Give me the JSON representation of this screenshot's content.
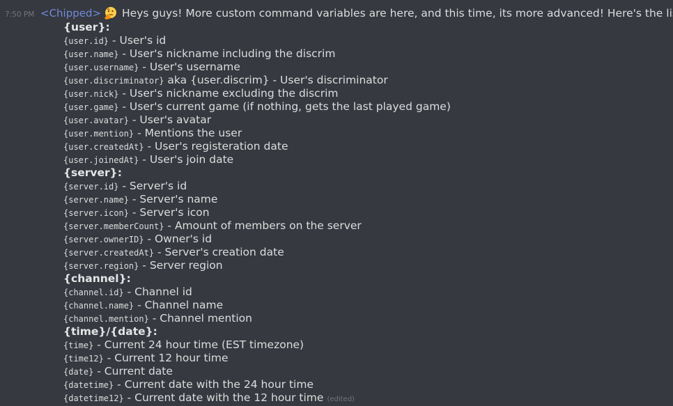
{
  "message": {
    "timestamp": "7:50 PM",
    "author": "<Chipped>",
    "emoji": "thinking-face-icon",
    "intro": "Heys guys! More custom command variables are here, and this time, its more advanced! Here's the list:",
    "edited_label": "(edited)",
    "lines": [
      {
        "type": "section",
        "text": "{user}:"
      },
      {
        "type": "item",
        "code": "{user.id}",
        "desc": " - User's id"
      },
      {
        "type": "item",
        "code": "{user.name}",
        "desc": " - User's nickname including the discrim"
      },
      {
        "type": "item",
        "code": "{user.username}",
        "desc": " - User's username"
      },
      {
        "type": "item",
        "code": "{user.discriminator}",
        "desc": " aka {user.discrim} - User's discriminator"
      },
      {
        "type": "item",
        "code": "{user.nick}",
        "desc": " - User's nickname excluding the discrim"
      },
      {
        "type": "item",
        "code": "{user.game}",
        "desc": " - User's current game (if nothing, gets the last played game)"
      },
      {
        "type": "item",
        "code": "{user.avatar}",
        "desc": " - User's avatar"
      },
      {
        "type": "item",
        "code": "{user.mention}",
        "desc": " - Mentions the user"
      },
      {
        "type": "item",
        "code": "{user.createdAt}",
        "desc": " - User's registeration date"
      },
      {
        "type": "item",
        "code": "{user.joinedAt}",
        "desc": " - User's join date"
      },
      {
        "type": "section",
        "text": "{server}:"
      },
      {
        "type": "item",
        "code": "{server.id}",
        "desc": " - Server's id"
      },
      {
        "type": "item",
        "code": "{server.name}",
        "desc": " - Server's name"
      },
      {
        "type": "item",
        "code": "{server.icon}",
        "desc": " - Server's icon"
      },
      {
        "type": "item",
        "code": "{server.memberCount}",
        "desc": " - Amount of members on the server"
      },
      {
        "type": "item",
        "code": "{server.ownerID}",
        "desc": " - Owner's id"
      },
      {
        "type": "item",
        "code": "{server.createdAt}",
        "desc": " - Server's creation date"
      },
      {
        "type": "item",
        "code": "{server.region}",
        "desc": " - Server region"
      },
      {
        "type": "section",
        "text": "{channel}:"
      },
      {
        "type": "item",
        "code": "{channel.id}",
        "desc": " - Channel id"
      },
      {
        "type": "item",
        "code": "{channel.name}",
        "desc": " - Channel name"
      },
      {
        "type": "item",
        "code": "{channel.mention}",
        "desc": " - Channel mention"
      },
      {
        "type": "section",
        "text": "{time}/{date}:"
      },
      {
        "type": "item",
        "code": "{time}",
        "desc": " - Current 24 hour time (EST timezone)"
      },
      {
        "type": "item",
        "code": "{time12}",
        "desc": " - Current 12 hour time"
      },
      {
        "type": "item",
        "code": "{date}",
        "desc": " - Current date"
      },
      {
        "type": "item",
        "code": "{datetime}",
        "desc": " - Current date with the 24 hour time"
      },
      {
        "type": "item",
        "code": "{datetime12}",
        "desc": " -  Current date with the 12 hour time",
        "edited": true
      }
    ]
  }
}
